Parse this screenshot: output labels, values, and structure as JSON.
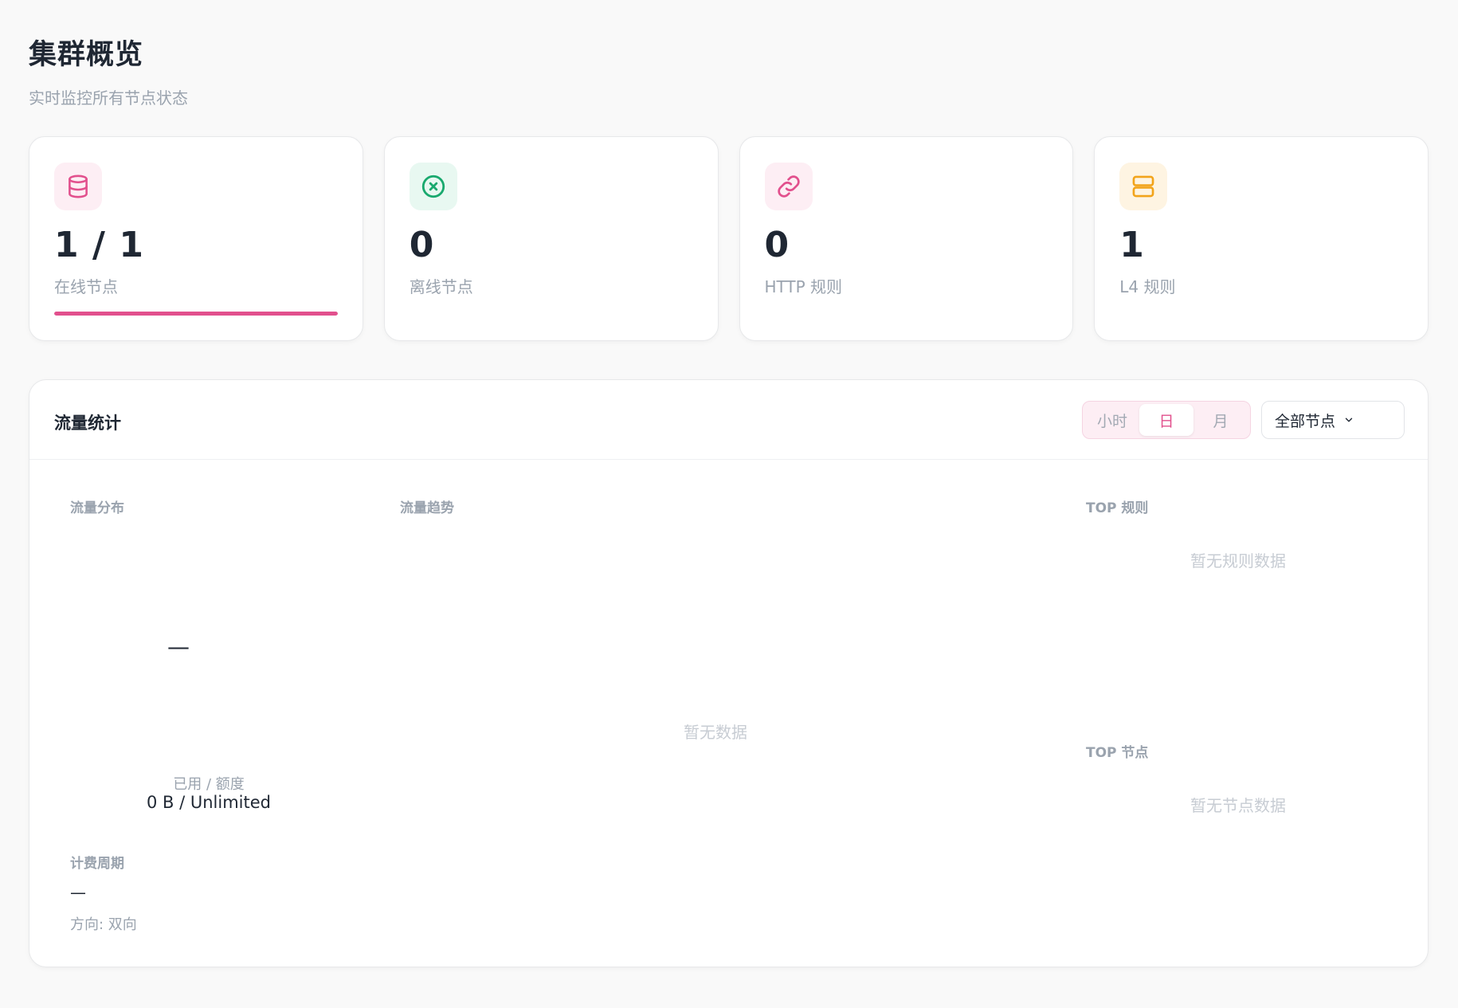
{
  "header": {
    "title": "集群概览",
    "subtitle": "实时监控所有节点状态"
  },
  "stats": [
    {
      "value": "1 / 1",
      "label": "在线节点",
      "icon": "database-icon",
      "color": "#e2508d",
      "progress": 1.0
    },
    {
      "value": "0",
      "label": "离线节点",
      "icon": "x-circle-icon",
      "color": "#19a96e"
    },
    {
      "value": "0",
      "label": "HTTP 规则",
      "icon": "link-icon",
      "color": "#e2508d"
    },
    {
      "value": "1",
      "label": "L4 规则",
      "icon": "server-icon",
      "color": "#f2a41b"
    }
  ],
  "traffic": {
    "title": "流量统计",
    "ranges": [
      "小时",
      "日",
      "月"
    ],
    "active_range": "日",
    "node_select": "全部节点",
    "distribution": {
      "label": "流量分布",
      "center_value": "—",
      "usage_caption": "已用 / 额度",
      "usage_value": "0 B / Unlimited"
    },
    "billing": {
      "label": "计费周期",
      "value": "—",
      "direction": "方向: 双向"
    },
    "trend": {
      "label": "流量趋势",
      "empty": "暂无数据"
    },
    "top_rules": {
      "label": "TOP 规则",
      "empty": "暂无规则数据"
    },
    "top_nodes": {
      "label": "TOP 节点",
      "empty": "暂无节点数据"
    }
  }
}
